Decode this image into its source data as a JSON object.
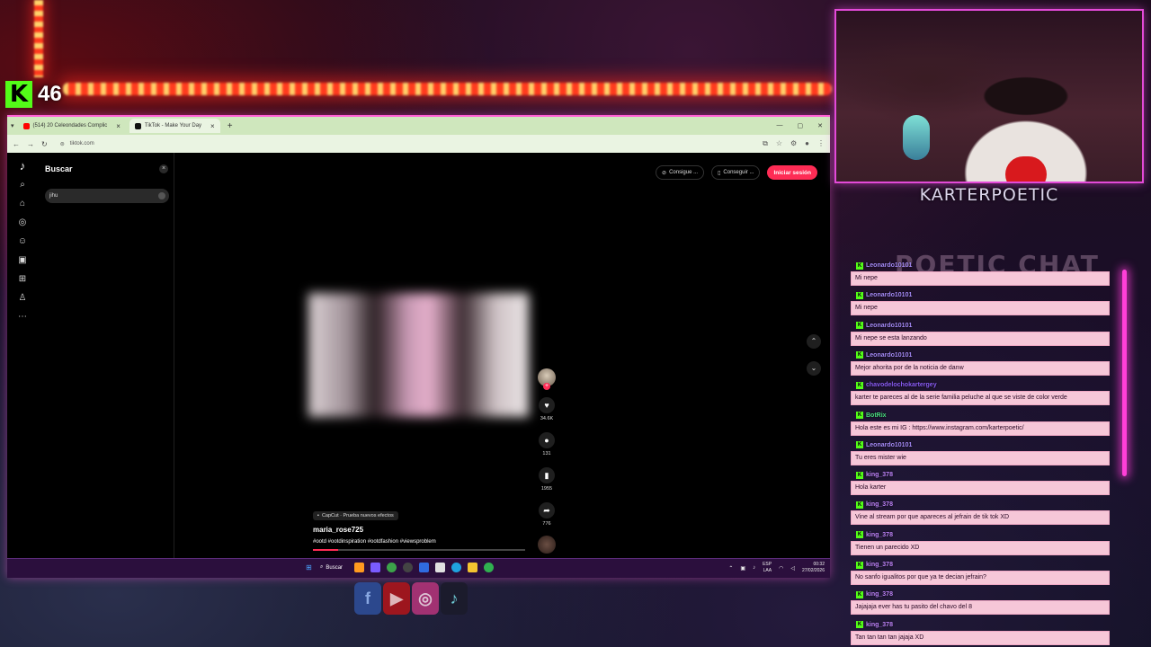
{
  "overlay": {
    "kick_badge": "K",
    "viewer_count": "46",
    "streamer_name": "KARTERPOETIC",
    "chat_title": "POETIC CHAT",
    "colors": {
      "kick_green": "#53fc18",
      "neon_pink": "#ff3fd8",
      "chat_bubble": "#f6c7d8"
    }
  },
  "browser": {
    "tabs": [
      {
        "label": "(514) 20 Celeondades Complic",
        "favicon": "youtube-icon",
        "active": false
      },
      {
        "label": "TikTok - Make Your Day",
        "favicon": "tiktok-icon",
        "active": true
      }
    ],
    "url": "tiktok.com"
  },
  "tiktok": {
    "search_title": "Buscar",
    "search_value": "jihu",
    "buttons": {
      "get_app": "Consigue ...",
      "get_coins": "Conseguir ...",
      "login": "Iniciar sesión"
    },
    "counts": {
      "likes": "34.6K",
      "comments": "131",
      "saves": "1955",
      "shares": "776"
    },
    "capcut_label": "CapCut · Prueba nuevos efectos",
    "author": "maria_rose725",
    "hashtags": "#ootd #ootdinspiration #ootdfashion #viewsproblem",
    "progress_fraction": 0.12
  },
  "taskbar": {
    "search": "Buscar",
    "lang_top": "ESP",
    "lang_bottom": "LAA",
    "time": "00:32",
    "date": "27/02/2026"
  },
  "chat": [
    {
      "user": "Leonardo10101",
      "color": "#a78bfa",
      "text": "Mi nepe"
    },
    {
      "user": "Leonardo10101",
      "color": "#a78bfa",
      "text": "Mi nepe"
    },
    {
      "user": "Leonardo10101",
      "color": "#a78bfa",
      "text": "Mi nepe se esta lanzando"
    },
    {
      "user": "Leonardo10101",
      "color": "#a78bfa",
      "text": "Mejor ahorita por de la noticia de danw"
    },
    {
      "user": "chavodelochokartergey",
      "color": "#8b5cf6",
      "text": "karter te pareces al de la serie familia peluche al que se viste de color verde"
    },
    {
      "user": "BotRix",
      "color": "#4ade80",
      "text": "Hola este es mi IG : https://www.instagram.com/karterpoetic/"
    },
    {
      "user": "Leonardo10101",
      "color": "#a78bfa",
      "text": "Tu eres mister wie"
    },
    {
      "user": "king_378",
      "color": "#c084fc",
      "text": "Hola karter"
    },
    {
      "user": "king_378",
      "color": "#c084fc",
      "text": "Vine al stream por que apareces al jefrain de tik tok XD"
    },
    {
      "user": "king_378",
      "color": "#c084fc",
      "text": "Tienen un parecido XD"
    },
    {
      "user": "king_378",
      "color": "#c084fc",
      "text": "No sanfo igualitos por que ya te decian jefrain?"
    },
    {
      "user": "king_378",
      "color": "#c084fc",
      "text": "Jajajaja ever has tu pasito del chavo del 8"
    },
    {
      "user": "king_378",
      "color": "#c084fc",
      "text": "Tan tan tan tan jajaja XD"
    }
  ]
}
